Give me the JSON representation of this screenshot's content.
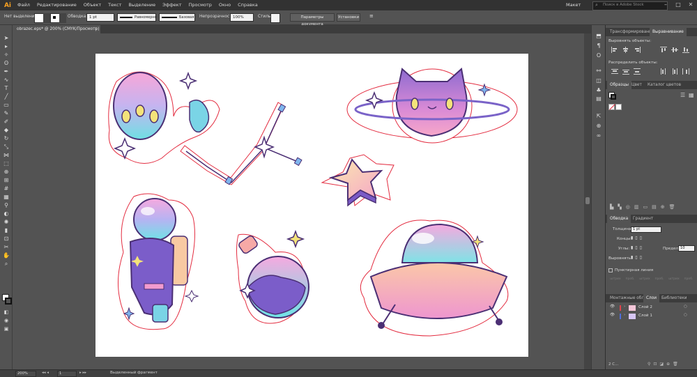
{
  "app": {
    "logo": "Ai",
    "menu": [
      "Файл",
      "Редактирование",
      "Объект",
      "Текст",
      "Выделение",
      "Эффект",
      "Просмотр",
      "Окно",
      "Справка"
    ],
    "workspace": "Макет",
    "search_placeholder": "Поиск в Adobe Stock"
  },
  "control_bar": {
    "selection": "Нет выделения",
    "stroke_label": "Обводка:",
    "stroke_value": "1 pt",
    "profile_label": "Равномерно",
    "brush_label": "Базовая",
    "opacity_label": "Непрозрачность:",
    "opacity_value": "100%",
    "styles_label": "Стиль:",
    "doc_settings": "Параметры документа",
    "preferences": "Установки"
  },
  "document": {
    "tab_title": "obrazec.eps* @ 200% (CMYK/Просмотр)"
  },
  "status": {
    "zoom": "200%",
    "artboard": "1",
    "selection_info": "Выделенный фрагмент"
  },
  "panels": {
    "transform_tab": "Трансформирование",
    "align_tab": "Выравнивание",
    "align_objects": "Выровнять объекты:",
    "distribute_objects": "Распределить объекты:",
    "swatches_tab": "Образцы",
    "color_tab": "Цвет",
    "color_guide_tab": "Каталог цветов",
    "stroke_tab": "Обводка",
    "gradient_tab": "Градиент",
    "weight_label": "Толщина:",
    "weight_value": "1 pt",
    "cap_label": "Концы:",
    "corner_label": "Углы:",
    "limit_label": "Предел:",
    "limit_value": "10",
    "align_stroke_label": "Выровнять:",
    "dashed_label": "Пунктирная линия",
    "dash_labels": [
      "штрих",
      "проб.",
      "штрих",
      "проб.",
      "штрих",
      "проб."
    ],
    "artboards_tab": "Монтажные обла",
    "layers_tab": "Слои",
    "libraries_tab": "Библиотеки",
    "layers": [
      {
        "name": "Слой 2",
        "color": "#e0434b"
      },
      {
        "name": "Слой 1",
        "color": "#4f6edb"
      }
    ],
    "layer_count": "2 С..."
  }
}
